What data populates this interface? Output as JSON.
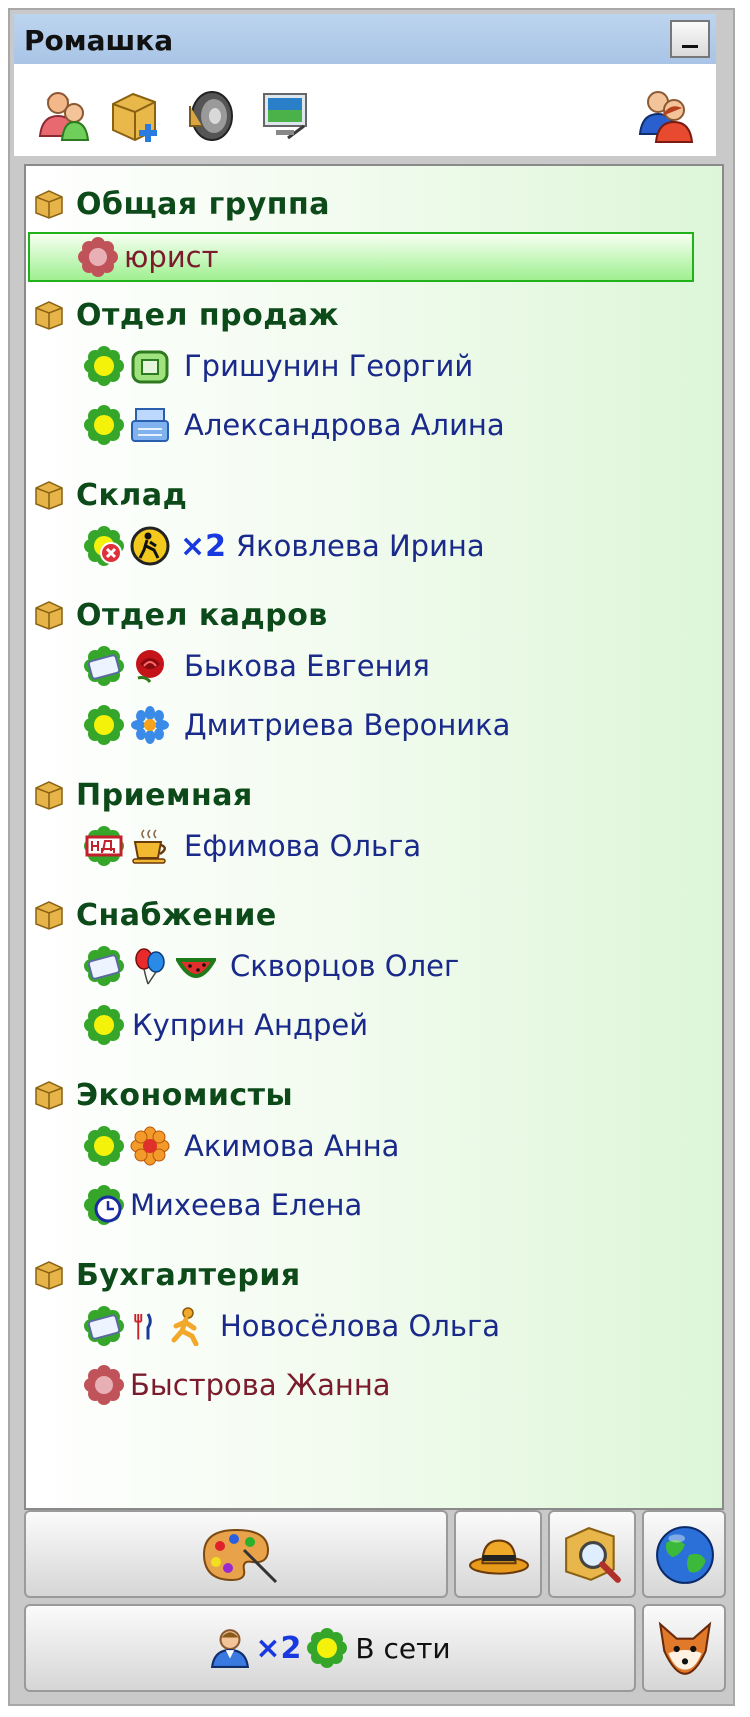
{
  "window": {
    "title": "Ромашка"
  },
  "toolbar": {
    "icons": [
      "add-contact-icon",
      "add-group-icon",
      "sound-icon",
      "monitor-icon",
      "users-icon"
    ]
  },
  "groups": [
    {
      "name": "Общая группа",
      "contacts": [
        {
          "name": "юрист",
          "status": "offline",
          "selected": true,
          "icons": []
        }
      ]
    },
    {
      "name": "Отдел продаж",
      "contacts": [
        {
          "name": "Гришунин Георгий",
          "status": "online",
          "icons": [
            "phone-icon"
          ]
        },
        {
          "name": "Александрова Алина",
          "status": "online",
          "icons": [
            "typewriter-icon"
          ]
        }
      ]
    },
    {
      "name": "Склад",
      "contacts": [
        {
          "name": "Яковлева Ирина",
          "status": "busy",
          "icons": [
            "worker-sign-icon"
          ],
          "multiplier": "×2"
        }
      ]
    },
    {
      "name": "Отдел кадров",
      "contacts": [
        {
          "name": "Быкова Евгения",
          "status": "away",
          "icons": [
            "rose-icon"
          ]
        },
        {
          "name": "Дмитриева Вероника",
          "status": "online",
          "icons": [
            "blue-flower-icon"
          ]
        }
      ]
    },
    {
      "name": "Приемная",
      "contacts": [
        {
          "name": "Ефимова Ольга",
          "status": "na",
          "icons": [
            "coffee-icon"
          ]
        }
      ]
    },
    {
      "name": "Снабжение",
      "contacts": [
        {
          "name": "Скворцов Олег",
          "status": "away",
          "icons": [
            "balloons-icon",
            "watermelon-icon"
          ]
        },
        {
          "name": "Куприн Андрей",
          "status": "online",
          "icons": []
        }
      ]
    },
    {
      "name": "Экономисты",
      "contacts": [
        {
          "name": "Акимова Анна",
          "status": "online",
          "icons": [
            "orange-flower-icon"
          ]
        },
        {
          "name": "Михеева Елена",
          "status": "clock",
          "icons": []
        }
      ]
    },
    {
      "name": "Бухгалтерия",
      "contacts": [
        {
          "name": "Новосёлова Ольга",
          "status": "away",
          "icons": [
            "fork-knife-icon",
            "running-man-icon"
          ]
        },
        {
          "name": "Быстрова Жанна",
          "status": "offline",
          "icons": []
        }
      ]
    }
  ],
  "bottom": {
    "status_label": "В сети",
    "users_multiplier": "×2",
    "buttons": [
      "palette-icon",
      "hat-icon",
      "search-icon",
      "globe-icon",
      "fox-icon"
    ]
  }
}
